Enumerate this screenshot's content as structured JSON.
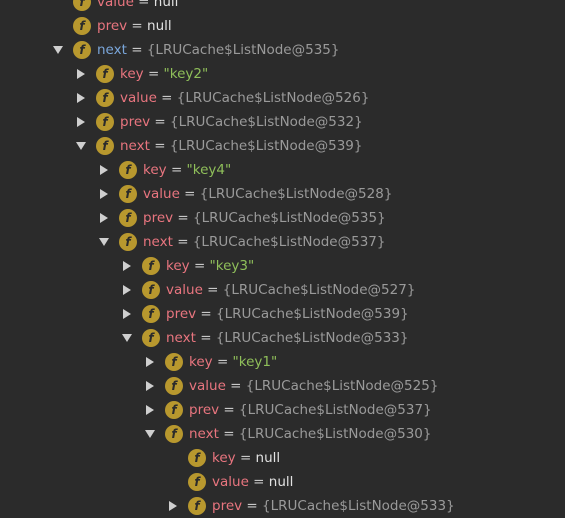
{
  "tree": {
    "field_badge": "f",
    "eq": "=",
    "rows": [
      {
        "name": "value",
        "value": "null",
        "kind": "null",
        "toggle": "none",
        "depth": 0
      },
      {
        "name": "prev",
        "value": "null",
        "kind": "null",
        "toggle": "none",
        "depth": 0
      },
      {
        "name": "next",
        "value": "{LRUCache$ListNode@535}",
        "kind": "obj",
        "toggle": "expanded",
        "depth": 0,
        "selected": true
      },
      {
        "name": "key",
        "value": "\"key2\"",
        "kind": "str",
        "toggle": "collapsed",
        "depth": 1
      },
      {
        "name": "value",
        "value": "{LRUCache$ListNode@526}",
        "kind": "obj",
        "toggle": "collapsed",
        "depth": 1
      },
      {
        "name": "prev",
        "value": "{LRUCache$ListNode@532}",
        "kind": "obj",
        "toggle": "collapsed",
        "depth": 1
      },
      {
        "name": "next",
        "value": "{LRUCache$ListNode@539}",
        "kind": "obj",
        "toggle": "expanded",
        "depth": 1
      },
      {
        "name": "key",
        "value": "\"key4\"",
        "kind": "str",
        "toggle": "collapsed",
        "depth": 2
      },
      {
        "name": "value",
        "value": "{LRUCache$ListNode@528}",
        "kind": "obj",
        "toggle": "collapsed",
        "depth": 2
      },
      {
        "name": "prev",
        "value": "{LRUCache$ListNode@535}",
        "kind": "obj",
        "toggle": "collapsed",
        "depth": 2
      },
      {
        "name": "next",
        "value": "{LRUCache$ListNode@537}",
        "kind": "obj",
        "toggle": "expanded",
        "depth": 2
      },
      {
        "name": "key",
        "value": "\"key3\"",
        "kind": "str",
        "toggle": "collapsed",
        "depth": 3
      },
      {
        "name": "value",
        "value": "{LRUCache$ListNode@527}",
        "kind": "obj",
        "toggle": "collapsed",
        "depth": 3
      },
      {
        "name": "prev",
        "value": "{LRUCache$ListNode@539}",
        "kind": "obj",
        "toggle": "collapsed",
        "depth": 3
      },
      {
        "name": "next",
        "value": "{LRUCache$ListNode@533}",
        "kind": "obj",
        "toggle": "expanded",
        "depth": 3
      },
      {
        "name": "key",
        "value": "\"key1\"",
        "kind": "str",
        "toggle": "collapsed",
        "depth": 4
      },
      {
        "name": "value",
        "value": "{LRUCache$ListNode@525}",
        "kind": "obj",
        "toggle": "collapsed",
        "depth": 4
      },
      {
        "name": "prev",
        "value": "{LRUCache$ListNode@537}",
        "kind": "obj",
        "toggle": "collapsed",
        "depth": 4
      },
      {
        "name": "next",
        "value": "{LRUCache$ListNode@530}",
        "kind": "obj",
        "toggle": "expanded",
        "depth": 4
      },
      {
        "name": "key",
        "value": "null",
        "kind": "null",
        "toggle": "none",
        "depth": 5
      },
      {
        "name": "value",
        "value": "null",
        "kind": "null",
        "toggle": "none",
        "depth": 5
      },
      {
        "name": "prev",
        "value": "{LRUCache$ListNode@533}",
        "kind": "obj",
        "toggle": "collapsed",
        "depth": 5
      }
    ]
  },
  "colors": {
    "background": "#2b2b2b",
    "field_name": "#e8757f",
    "selected_name": "#7aa6da",
    "string_value": "#8fbf5a",
    "null_value": "#e2e2e2",
    "object_value": "#9a9a9a",
    "field_icon": "#b8982e"
  },
  "icons": {
    "field": "field-f-icon",
    "collapsed": "triangle-right-icon",
    "expanded": "triangle-down-icon"
  }
}
